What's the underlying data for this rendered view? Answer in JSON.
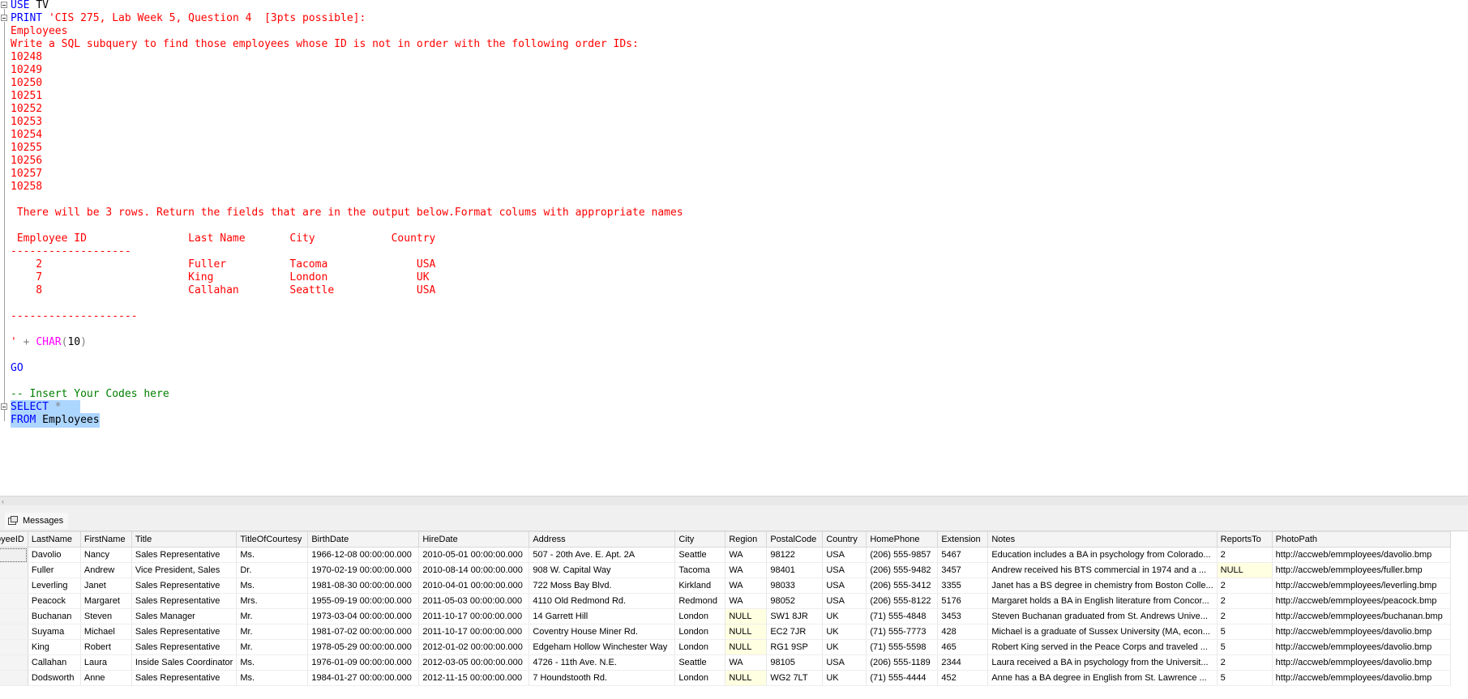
{
  "editor": {
    "use_keyword": "USE",
    "use_db": "TV",
    "print_keyword": "PRINT",
    "print_lines": [
      "'CIS 275, Lab Week 5, Question 4  [3pts possible]:",
      "Employees",
      "Write a SQL subquery to find those employees whose ID is not in order with the following order IDs:",
      "10248",
      "10249",
      "10250",
      "10251",
      "10252",
      "10253",
      "10254",
      "10255",
      "10256",
      "10257",
      "10258",
      "",
      " There will be 3 rows. Return the fields that are in the output below.Format colums with appropriate names",
      "",
      " Employee ID                Last Name       City            Country",
      "-------------------",
      "    2                       Fuller          Tacoma              USA",
      "    7                       King            London              UK",
      "    8                       Callahan        Seattle             USA",
      "",
      "--------------------",
      "",
      ""
    ],
    "closing_quote": "'",
    "plus": "+",
    "char_fn": "CHAR",
    "char_open": "(",
    "char_arg": "10",
    "char_close": ")",
    "go": "GO",
    "comment": "-- Insert Your Codes here",
    "select_keyword": "SELECT",
    "select_star": "*",
    "from_keyword": "FROM",
    "from_table": "Employees"
  },
  "results": {
    "messages_tab_label": "Messages",
    "columns": [
      "oyeeID",
      "LastName",
      "FirstName",
      "Title",
      "TitleOfCourtesy",
      "BirthDate",
      "HireDate",
      "Address",
      "City",
      "Region",
      "PostalCode",
      "Country",
      "HomePhone",
      "Extension",
      "Notes",
      "ReportsTo",
      "PhotoPath"
    ],
    "rows": [
      [
        "",
        "Davolio",
        "Nancy",
        "Sales Representative",
        "Ms.",
        "1966-12-08 00:00:00.000",
        "2010-05-01 00:00:00.000",
        "507 - 20th Ave. E.  Apt. 2A",
        "Seattle",
        "WA",
        "98122",
        "USA",
        "(206) 555-9857",
        "5467",
        "Education includes a BA in psychology from Colorado...",
        "2",
        "http://accweb/emmployees/davolio.bmp"
      ],
      [
        "",
        "Fuller",
        "Andrew",
        "Vice President, Sales",
        "Dr.",
        "1970-02-19 00:00:00.000",
        "2010-08-14 00:00:00.000",
        "908 W. Capital Way",
        "Tacoma",
        "WA",
        "98401",
        "USA",
        "(206) 555-9482",
        "3457",
        "Andrew received his BTS commercial in 1974 and a ...",
        "NULL",
        "http://accweb/emmployees/fuller.bmp"
      ],
      [
        "",
        "Leverling",
        "Janet",
        "Sales Representative",
        "Ms.",
        "1981-08-30 00:00:00.000",
        "2010-04-01 00:00:00.000",
        "722 Moss Bay Blvd.",
        "Kirkland",
        "WA",
        "98033",
        "USA",
        "(206) 555-3412",
        "3355",
        "Janet has a BS degree in chemistry from Boston Colle...",
        "2",
        "http://accweb/emmployees/leverling.bmp"
      ],
      [
        "",
        "Peacock",
        "Margaret",
        "Sales Representative",
        "Mrs.",
        "1955-09-19 00:00:00.000",
        "2011-05-03 00:00:00.000",
        "4110 Old Redmond Rd.",
        "Redmond",
        "WA",
        "98052",
        "USA",
        "(206) 555-8122",
        "5176",
        "Margaret holds a BA in English literature from Concor...",
        "2",
        "http://accweb/emmployees/peacock.bmp"
      ],
      [
        "",
        "Buchanan",
        "Steven",
        "Sales Manager",
        "Mr.",
        "1973-03-04 00:00:00.000",
        "2011-10-17 00:00:00.000",
        "14 Garrett Hill",
        "London",
        "NULL",
        "SW1 8JR",
        "UK",
        "(71) 555-4848",
        "3453",
        "Steven Buchanan graduated from St. Andrews Unive...",
        "2",
        "http://accweb/emmployees/buchanan.bmp"
      ],
      [
        "",
        "Suyama",
        "Michael",
        "Sales Representative",
        "Mr.",
        "1981-07-02 00:00:00.000",
        "2011-10-17 00:00:00.000",
        "Coventry House  Miner Rd.",
        "London",
        "NULL",
        "EC2 7JR",
        "UK",
        "(71) 555-7773",
        "428",
        "Michael is a graduate of Sussex University (MA, econ...",
        "5",
        "http://accweb/emmployees/davolio.bmp"
      ],
      [
        "",
        "King",
        "Robert",
        "Sales Representative",
        "Mr.",
        "1978-05-29 00:00:00.000",
        "2012-01-02 00:00:00.000",
        "Edgeham Hollow  Winchester Way",
        "London",
        "NULL",
        "RG1 9SP",
        "UK",
        "(71) 555-5598",
        "465",
        "Robert King served in the Peace Corps and traveled ...",
        "5",
        "http://accweb/emmployees/davolio.bmp"
      ],
      [
        "",
        "Callahan",
        "Laura",
        "Inside Sales Coordinator",
        "Ms.",
        "1976-01-09 00:00:00.000",
        "2012-03-05 00:00:00.000",
        "4726 - 11th Ave. N.E.",
        "Seattle",
        "WA",
        "98105",
        "USA",
        "(206) 555-1189",
        "2344",
        "Laura received a BA in psychology from the Universit...",
        "2",
        "http://accweb/emmployees/davolio.bmp"
      ],
      [
        "",
        "Dodsworth",
        "Anne",
        "Sales Representative",
        "Ms.",
        "1984-01-27 00:00:00.000",
        "2012-11-15 00:00:00.000",
        "7 Houndstooth Rd.",
        "London",
        "NULL",
        "WG2 7LT",
        "UK",
        "(71) 555-4444",
        "452",
        "Anne has a BA degree in English from St. Lawrence ...",
        "5",
        "http://accweb/emmployees/davolio.bmp"
      ]
    ]
  }
}
